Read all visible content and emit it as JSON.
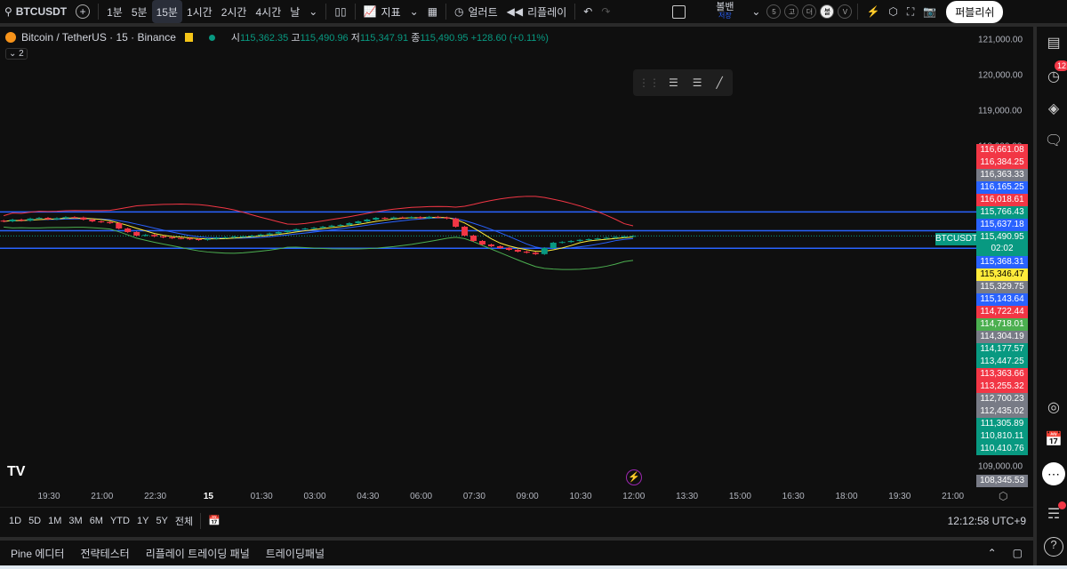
{
  "toolbar": {
    "symbol": "BTCUSDT",
    "intervals": [
      "1분",
      "5분",
      "15분",
      "1시간",
      "2시간",
      "4시간",
      "날"
    ],
    "active_interval": "15분",
    "indicators": "지표",
    "alert": "얼러트",
    "replay": "리플레이",
    "layout_name": "볼밴",
    "layout_save": "저장",
    "quick": [
      "5",
      "고",
      "더",
      "볼",
      "V"
    ],
    "publish": "퍼블리쉬"
  },
  "legend": {
    "title": "Bitcoin / TetherUS · 15 · Binance",
    "o_label": "시",
    "o": "115,362.35",
    "h_label": "고",
    "h": "115,490.96",
    "l_label": "저",
    "l": "115,347.91",
    "c_label": "종",
    "c": "115,490.95",
    "change": "+128.60 (+0.11%)",
    "collapsed_count": "2"
  },
  "price_axis": {
    "ticks": [
      "121,000.00",
      "120,000.00",
      "119,000.00",
      "118,000.00",
      "109,000.00"
    ],
    "symbol_tag": "BTCUSDT",
    "countdown": "02:02"
  },
  "price_badges": [
    {
      "v": "116,661.08",
      "c": "#f23645"
    },
    {
      "v": "116,384.25",
      "c": "#f23645"
    },
    {
      "v": "116,363.33",
      "c": "#787b86"
    },
    {
      "v": "116,165.25",
      "c": "#2962ff"
    },
    {
      "v": "116,018.61",
      "c": "#f23645"
    },
    {
      "v": "115,766.43",
      "c": "#089981"
    },
    {
      "v": "115,637.18",
      "c": "#2962ff"
    },
    {
      "v": "115,490.95",
      "c": "#089981"
    },
    {
      "v": "115,368.31",
      "c": "#2962ff"
    },
    {
      "v": "115,346.47",
      "c": "#ffeb3b"
    },
    {
      "v": "115,329.75",
      "c": "#787b86"
    },
    {
      "v": "115,143.64",
      "c": "#2962ff"
    },
    {
      "v": "114,722.44",
      "c": "#f23645"
    },
    {
      "v": "114,718.01",
      "c": "#4caf50"
    },
    {
      "v": "114,304.19",
      "c": "#787b86"
    },
    {
      "v": "114,177.57",
      "c": "#089981"
    },
    {
      "v": "113,447.25",
      "c": "#089981"
    },
    {
      "v": "113,363.66",
      "c": "#f23645"
    },
    {
      "v": "113,255.32",
      "c": "#f23645"
    },
    {
      "v": "112,700.23",
      "c": "#787b86"
    },
    {
      "v": "112,435.02",
      "c": "#787b86"
    },
    {
      "v": "111,305.89",
      "c": "#089981"
    },
    {
      "v": "110,810.11",
      "c": "#089981"
    },
    {
      "v": "110,410.76",
      "c": "#089981"
    }
  ],
  "last_badge": "108,345.53",
  "time_axis": [
    "19:30",
    "21:00",
    "22:30",
    "15",
    "01:30",
    "03:00",
    "04:30",
    "06:00",
    "07:30",
    "09:00",
    "10:30",
    "12:00",
    "13:30",
    "15:00",
    "16:30",
    "18:00",
    "19:30",
    "21:00"
  ],
  "ranges": [
    "1D",
    "5D",
    "1M",
    "3M",
    "6M",
    "YTD",
    "1Y",
    "5Y",
    "전체"
  ],
  "clock": "12:12:58 UTC+9",
  "panels": [
    "Pine 에디터",
    "전략테스터",
    "리플레이 트레이딩 패널",
    "트레이딩패널"
  ],
  "sidebar": {
    "alerts_count": "12"
  },
  "chart_data": {
    "type": "candlestick",
    "symbol": "BTCUSDT",
    "interval": "15",
    "ylim": [
      108200,
      121400
    ],
    "hlines": [
      116165.25,
      115637.18,
      115143.64
    ],
    "closes": [
      115900,
      115950,
      115920,
      115980,
      116000,
      115960,
      115990,
      116020,
      116010,
      115950,
      115900,
      115880,
      115850,
      115700,
      115600,
      115500,
      115520,
      115480,
      115450,
      115430,
      115420,
      115400,
      115380,
      115410,
      115440,
      115450,
      115470,
      115480,
      115500,
      115530,
      115560,
      115600,
      115640,
      115680,
      115700,
      115720,
      115750,
      115780,
      115800,
      115850,
      115900,
      115950,
      116000,
      115980,
      116010,
      116000,
      116020,
      115990,
      116030,
      116010,
      115980,
      115750,
      115500,
      115350,
      115250,
      115200,
      115150,
      115100,
      115050,
      115020,
      114980,
      115150,
      115300,
      115320,
      115350,
      115380,
      115400,
      115420,
      115440,
      115460,
      115480,
      115490.95
    ],
    "colors": {
      "up": "#089981",
      "down": "#f23645",
      "upper": "#f23645",
      "lower": "#4caf50",
      "ma_fast": "#ffeb3b",
      "ma_slow": "#2962ff",
      "hline": "#2962ff"
    }
  }
}
